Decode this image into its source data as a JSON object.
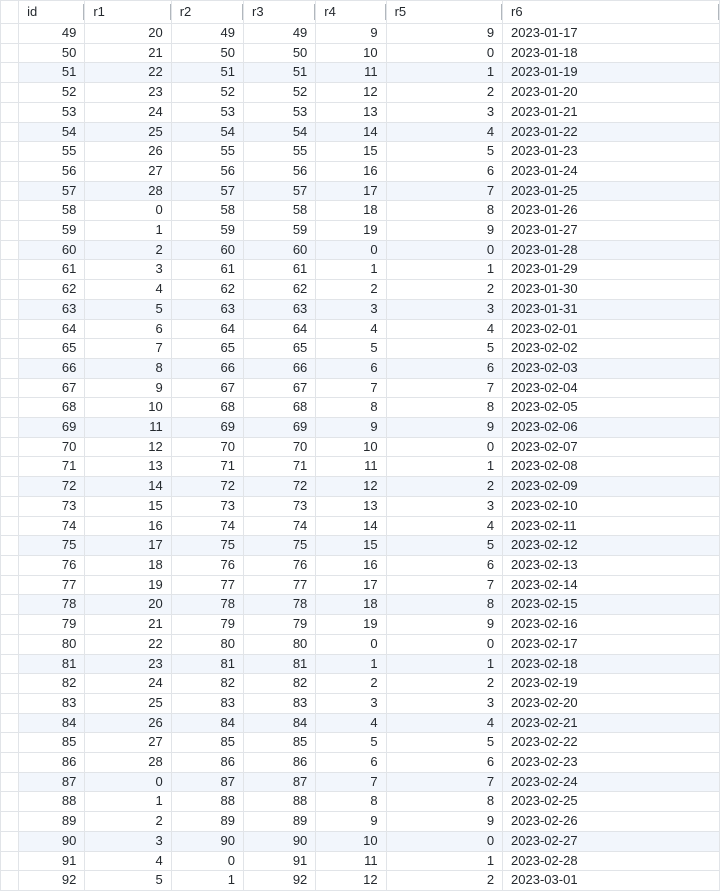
{
  "columns": [
    {
      "key": "id",
      "label": "id",
      "align": "num"
    },
    {
      "key": "r1",
      "label": "r1",
      "align": "num"
    },
    {
      "key": "r2",
      "label": "r2",
      "align": "num"
    },
    {
      "key": "r3",
      "label": "r3",
      "align": "num"
    },
    {
      "key": "r4",
      "label": "r4",
      "align": "num"
    },
    {
      "key": "r5",
      "label": "r5",
      "align": "num"
    },
    {
      "key": "r6",
      "label": "r6",
      "align": "txt"
    }
  ],
  "rows": [
    {
      "id": 49,
      "r1": 20,
      "r2": 49,
      "r3": 49,
      "r4": 9,
      "r5": 9,
      "r6": "2023-01-17"
    },
    {
      "id": 50,
      "r1": 21,
      "r2": 50,
      "r3": 50,
      "r4": 10,
      "r5": 0,
      "r6": "2023-01-18"
    },
    {
      "id": 51,
      "r1": 22,
      "r2": 51,
      "r3": 51,
      "r4": 11,
      "r5": 1,
      "r6": "2023-01-19"
    },
    {
      "id": 52,
      "r1": 23,
      "r2": 52,
      "r3": 52,
      "r4": 12,
      "r5": 2,
      "r6": "2023-01-20"
    },
    {
      "id": 53,
      "r1": 24,
      "r2": 53,
      "r3": 53,
      "r4": 13,
      "r5": 3,
      "r6": "2023-01-21"
    },
    {
      "id": 54,
      "r1": 25,
      "r2": 54,
      "r3": 54,
      "r4": 14,
      "r5": 4,
      "r6": "2023-01-22"
    },
    {
      "id": 55,
      "r1": 26,
      "r2": 55,
      "r3": 55,
      "r4": 15,
      "r5": 5,
      "r6": "2023-01-23"
    },
    {
      "id": 56,
      "r1": 27,
      "r2": 56,
      "r3": 56,
      "r4": 16,
      "r5": 6,
      "r6": "2023-01-24"
    },
    {
      "id": 57,
      "r1": 28,
      "r2": 57,
      "r3": 57,
      "r4": 17,
      "r5": 7,
      "r6": "2023-01-25"
    },
    {
      "id": 58,
      "r1": 0,
      "r2": 58,
      "r3": 58,
      "r4": 18,
      "r5": 8,
      "r6": "2023-01-26"
    },
    {
      "id": 59,
      "r1": 1,
      "r2": 59,
      "r3": 59,
      "r4": 19,
      "r5": 9,
      "r6": "2023-01-27"
    },
    {
      "id": 60,
      "r1": 2,
      "r2": 60,
      "r3": 60,
      "r4": 0,
      "r5": 0,
      "r6": "2023-01-28"
    },
    {
      "id": 61,
      "r1": 3,
      "r2": 61,
      "r3": 61,
      "r4": 1,
      "r5": 1,
      "r6": "2023-01-29"
    },
    {
      "id": 62,
      "r1": 4,
      "r2": 62,
      "r3": 62,
      "r4": 2,
      "r5": 2,
      "r6": "2023-01-30"
    },
    {
      "id": 63,
      "r1": 5,
      "r2": 63,
      "r3": 63,
      "r4": 3,
      "r5": 3,
      "r6": "2023-01-31"
    },
    {
      "id": 64,
      "r1": 6,
      "r2": 64,
      "r3": 64,
      "r4": 4,
      "r5": 4,
      "r6": "2023-02-01"
    },
    {
      "id": 65,
      "r1": 7,
      "r2": 65,
      "r3": 65,
      "r4": 5,
      "r5": 5,
      "r6": "2023-02-02"
    },
    {
      "id": 66,
      "r1": 8,
      "r2": 66,
      "r3": 66,
      "r4": 6,
      "r5": 6,
      "r6": "2023-02-03"
    },
    {
      "id": 67,
      "r1": 9,
      "r2": 67,
      "r3": 67,
      "r4": 7,
      "r5": 7,
      "r6": "2023-02-04"
    },
    {
      "id": 68,
      "r1": 10,
      "r2": 68,
      "r3": 68,
      "r4": 8,
      "r5": 8,
      "r6": "2023-02-05"
    },
    {
      "id": 69,
      "r1": 11,
      "r2": 69,
      "r3": 69,
      "r4": 9,
      "r5": 9,
      "r6": "2023-02-06"
    },
    {
      "id": 70,
      "r1": 12,
      "r2": 70,
      "r3": 70,
      "r4": 10,
      "r5": 0,
      "r6": "2023-02-07"
    },
    {
      "id": 71,
      "r1": 13,
      "r2": 71,
      "r3": 71,
      "r4": 11,
      "r5": 1,
      "r6": "2023-02-08"
    },
    {
      "id": 72,
      "r1": 14,
      "r2": 72,
      "r3": 72,
      "r4": 12,
      "r5": 2,
      "r6": "2023-02-09"
    },
    {
      "id": 73,
      "r1": 15,
      "r2": 73,
      "r3": 73,
      "r4": 13,
      "r5": 3,
      "r6": "2023-02-10"
    },
    {
      "id": 74,
      "r1": 16,
      "r2": 74,
      "r3": 74,
      "r4": 14,
      "r5": 4,
      "r6": "2023-02-11"
    },
    {
      "id": 75,
      "r1": 17,
      "r2": 75,
      "r3": 75,
      "r4": 15,
      "r5": 5,
      "r6": "2023-02-12"
    },
    {
      "id": 76,
      "r1": 18,
      "r2": 76,
      "r3": 76,
      "r4": 16,
      "r5": 6,
      "r6": "2023-02-13"
    },
    {
      "id": 77,
      "r1": 19,
      "r2": 77,
      "r3": 77,
      "r4": 17,
      "r5": 7,
      "r6": "2023-02-14"
    },
    {
      "id": 78,
      "r1": 20,
      "r2": 78,
      "r3": 78,
      "r4": 18,
      "r5": 8,
      "r6": "2023-02-15"
    },
    {
      "id": 79,
      "r1": 21,
      "r2": 79,
      "r3": 79,
      "r4": 19,
      "r5": 9,
      "r6": "2023-02-16"
    },
    {
      "id": 80,
      "r1": 22,
      "r2": 80,
      "r3": 80,
      "r4": 0,
      "r5": 0,
      "r6": "2023-02-17"
    },
    {
      "id": 81,
      "r1": 23,
      "r2": 81,
      "r3": 81,
      "r4": 1,
      "r5": 1,
      "r6": "2023-02-18"
    },
    {
      "id": 82,
      "r1": 24,
      "r2": 82,
      "r3": 82,
      "r4": 2,
      "r5": 2,
      "r6": "2023-02-19"
    },
    {
      "id": 83,
      "r1": 25,
      "r2": 83,
      "r3": 83,
      "r4": 3,
      "r5": 3,
      "r6": "2023-02-20"
    },
    {
      "id": 84,
      "r1": 26,
      "r2": 84,
      "r3": 84,
      "r4": 4,
      "r5": 4,
      "r6": "2023-02-21"
    },
    {
      "id": 85,
      "r1": 27,
      "r2": 85,
      "r3": 85,
      "r4": 5,
      "r5": 5,
      "r6": "2023-02-22"
    },
    {
      "id": 86,
      "r1": 28,
      "r2": 86,
      "r3": 86,
      "r4": 6,
      "r5": 6,
      "r6": "2023-02-23"
    },
    {
      "id": 87,
      "r1": 0,
      "r2": 87,
      "r3": 87,
      "r4": 7,
      "r5": 7,
      "r6": "2023-02-24"
    },
    {
      "id": 88,
      "r1": 1,
      "r2": 88,
      "r3": 88,
      "r4": 8,
      "r5": 8,
      "r6": "2023-02-25"
    },
    {
      "id": 89,
      "r1": 2,
      "r2": 89,
      "r3": 89,
      "r4": 9,
      "r5": 9,
      "r6": "2023-02-26"
    },
    {
      "id": 90,
      "r1": 3,
      "r2": 90,
      "r3": 90,
      "r4": 10,
      "r5": 0,
      "r6": "2023-02-27"
    },
    {
      "id": 91,
      "r1": 4,
      "r2": 0,
      "r3": 91,
      "r4": 11,
      "r5": 1,
      "r6": "2023-02-28"
    },
    {
      "id": 92,
      "r1": 5,
      "r2": 1,
      "r3": 92,
      "r4": 12,
      "r5": 2,
      "r6": "2023-03-01"
    }
  ]
}
